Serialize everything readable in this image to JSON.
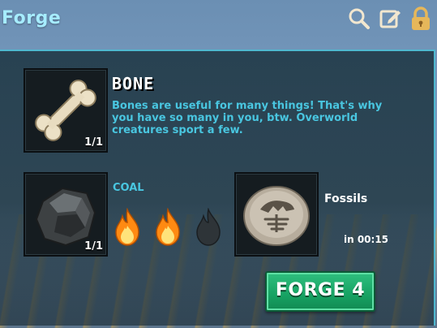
{
  "header": {
    "title": "Forge",
    "icons": [
      "search-icon",
      "edit-icon",
      "lock-icon"
    ]
  },
  "ingredient": {
    "icon": "bone-icon",
    "name": "BONE",
    "count": "1/1",
    "description": "Bones are useful for many things! That's why you have so many in you, btw. Overworld creatures sport a few."
  },
  "fuel": {
    "icon": "coal-icon",
    "label": "COAL",
    "count": "1/1",
    "flames_total": 3,
    "flames_lit": 2
  },
  "result": {
    "icon": "fossil-icon",
    "name": "Fossils",
    "timer": "in 00:15"
  },
  "action": {
    "label": "FORGE 4"
  },
  "colors": {
    "title": "#a6ecff",
    "accent_text": "#49c6e0",
    "panel_border": "#4fb8cf",
    "button": "#17a263",
    "flame_lit": "#ffb020",
    "flame_unlit": "#2e3438"
  }
}
